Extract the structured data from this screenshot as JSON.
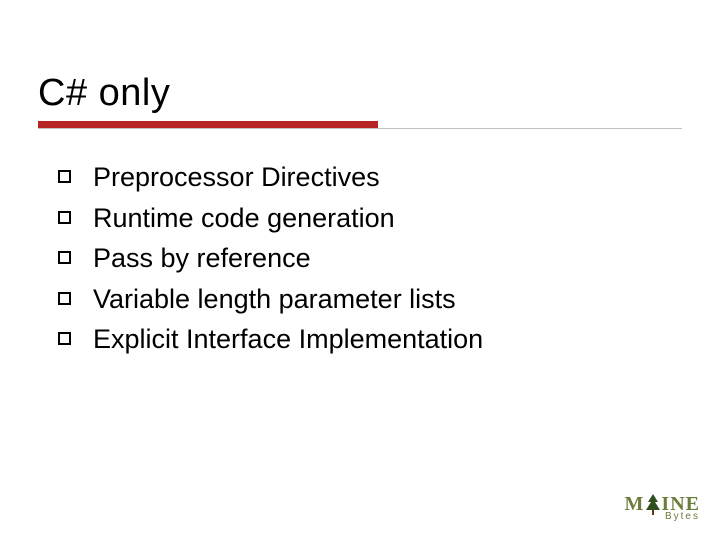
{
  "slide": {
    "title": "C# only",
    "bullets": [
      "Preprocessor Directives",
      "Runtime code generation",
      "Pass by reference",
      "Variable length parameter lists",
      "Explicit Interface Implementation"
    ],
    "logo": {
      "top_left": "M",
      "top_right": "INE",
      "bottom": "Bytes"
    }
  }
}
